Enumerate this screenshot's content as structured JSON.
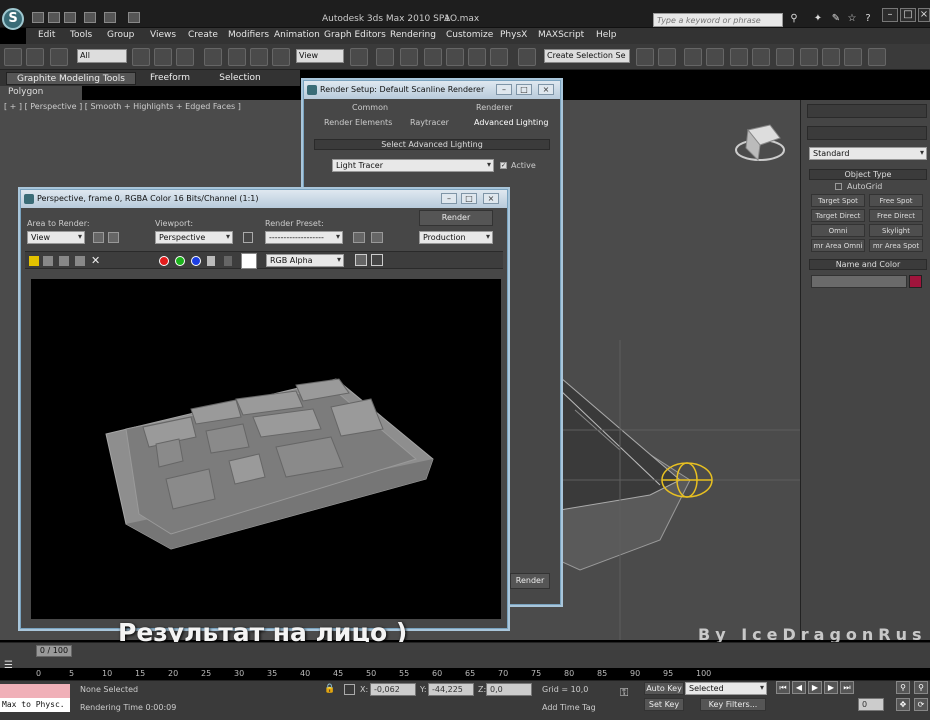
{
  "app": {
    "title": "Autodesk 3ds Max  2010 SP1",
    "file": "AO.max",
    "logo": "S",
    "search_placeholder": "Type a keyword or phrase"
  },
  "menus": [
    "Edit",
    "Tools",
    "Group",
    "Views",
    "Create",
    "Modifiers",
    "Animation",
    "Graph Editors",
    "Rendering",
    "Customize",
    "PhysX",
    "MAXScript",
    "Help"
  ],
  "toolbar": {
    "filter": "All",
    "view": "View",
    "selection_set": "Create Selection Se"
  },
  "graphite": {
    "tabs": [
      "Graphite Modeling Tools",
      "Freeform",
      "Selection"
    ],
    "panel": "Polygon Modeling"
  },
  "viewport": {
    "label": "[ + ] [ Perspective ] [ Smooth + Highlights + Edged Faces ]"
  },
  "render_setup": {
    "title": "Render Setup: Default Scanline Renderer",
    "tabs": [
      "Common",
      "Renderer",
      "Render Elements",
      "Raytracer",
      "Advanced Lighting"
    ],
    "section": "Select Advanced Lighting",
    "lighting": "Light Tracer",
    "active": "Active",
    "render": "Render"
  },
  "frame_window": {
    "title": "Perspective, frame 0, RGBA Color 16 Bits/Channel (1:1)",
    "area_label": "Area to Render:",
    "area": "View",
    "viewport_label": "Viewport:",
    "viewport": "Perspective",
    "preset_label": "Render Preset:",
    "preset": "-------------------",
    "render": "Render",
    "mode": "Production",
    "channel": "RGB Alpha"
  },
  "command_panel": {
    "category": "Standard",
    "object_type": "Object Type",
    "autogrid": "AutoGrid",
    "buttons": [
      "Target Spot",
      "Free Spot",
      "Target Direct",
      "Free Direct",
      "Omni",
      "Skylight",
      "mr Area Omni",
      "mr Area Spot"
    ],
    "name_color": "Name and Color",
    "swatch": "#a0143c"
  },
  "overlay": {
    "subtitle": "Результат на лицо )",
    "watermark": "By IceDragonRus"
  },
  "timeline": {
    "position": "0 / 100",
    "ticks": [
      "0",
      "5",
      "10",
      "15",
      "20",
      "25",
      "30",
      "35",
      "40",
      "45",
      "50",
      "55",
      "60",
      "65",
      "70",
      "75",
      "80",
      "85",
      "90",
      "95",
      "100"
    ]
  },
  "status": {
    "script": "Max to Physc.",
    "selection": "None Selected",
    "render_time": "Rendering Time  0:00:09",
    "x": "-0,062",
    "y": "-44,225",
    "z": "0,0",
    "grid": "Grid = 10,0",
    "add_time_tag": "Add Time Tag",
    "auto_key": "Auto Key",
    "key_mode": "Selected",
    "set_key": "Set Key",
    "key_filters": "Key Filters...",
    "frame": "0"
  }
}
